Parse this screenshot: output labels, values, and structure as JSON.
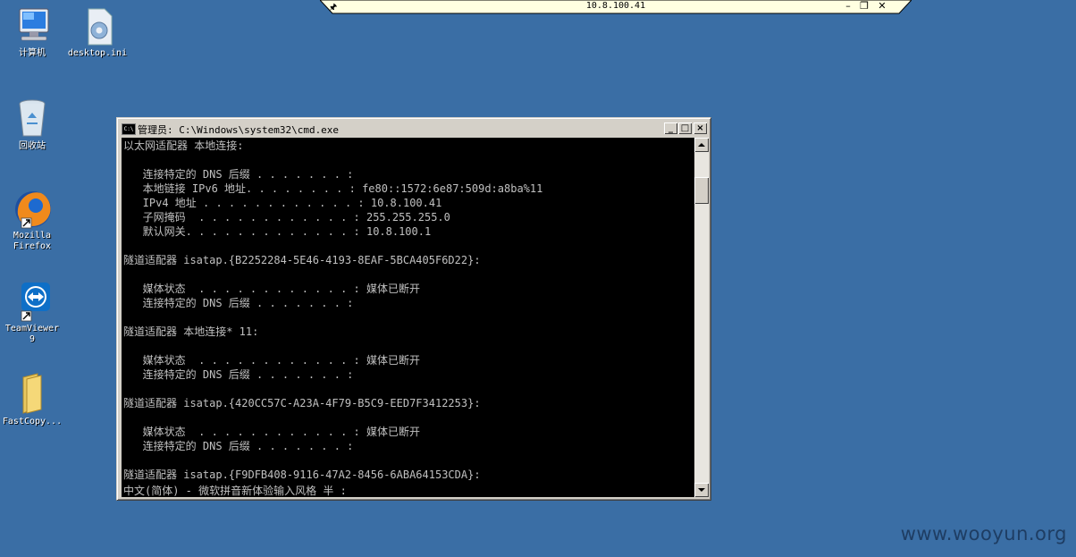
{
  "rdp_bar": {
    "title": "10.8.100.41",
    "pin_icon": "pin-icon",
    "buttons": [
      "minimize",
      "restore",
      "close"
    ]
  },
  "desktop": {
    "background_color": "#3a6ea5",
    "icons": [
      {
        "label": "计算机",
        "icon": "computer-icon"
      },
      {
        "label": "desktop.ini",
        "icon": "settings-file-icon"
      },
      {
        "label": "回收站",
        "icon": "recycle-bin-icon"
      },
      {
        "label": "Mozilla Firefox",
        "label_line1": "Mozilla",
        "label_line2": "Firefox",
        "icon": "firefox-icon"
      },
      {
        "label": "TeamViewer 9",
        "label_line1": "TeamViewer",
        "label_line2": "9",
        "icon": "teamviewer-icon"
      },
      {
        "label": "FastCopy...",
        "icon": "folder-icon"
      }
    ]
  },
  "cmd_window": {
    "title": "管理员: C:\\Windows\\system32\\cmd.exe",
    "icon_text": "C:\\",
    "lines": [
      "以太网适配器 本地连接:",
      "",
      "   连接特定的 DNS 后缀 . . . . . . . :",
      "   本地链接 IPv6 地址. . . . . . . . : fe80::1572:6e87:509d:a8ba%11",
      "   IPv4 地址 . . . . . . . . . . . . : 10.8.100.41",
      "   子网掩码  . . . . . . . . . . . . : 255.255.255.0",
      "   默认网关. . . . . . . . . . . . . : 10.8.100.1",
      "",
      "隧道适配器 isatap.{B2252284-5E46-4193-8EAF-5BCA405F6D22}:",
      "",
      "   媒体状态  . . . . . . . . . . . . : 媒体已断开",
      "   连接特定的 DNS 后缀 . . . . . . . :",
      "",
      "隧道适配器 本地连接* 11:",
      "",
      "   媒体状态  . . . . . . . . . . . . : 媒体已断开",
      "   连接特定的 DNS 后缀 . . . . . . . :",
      "",
      "隧道适配器 isatap.{420CC57C-A23A-4F79-B5C9-EED7F3412253}:",
      "",
      "   媒体状态  . . . . . . . . . . . . : 媒体已断开",
      "   连接特定的 DNS 后缀 . . . . . . . :",
      "",
      "隧道适配器 isatap.{F9DFB408-9116-47A2-8456-6ABA64153CDA}:"
    ],
    "ime_status": "中文(简体) - 微软拼音新体验输入风格 半 :"
  },
  "watermark": "www.wooyun.org"
}
